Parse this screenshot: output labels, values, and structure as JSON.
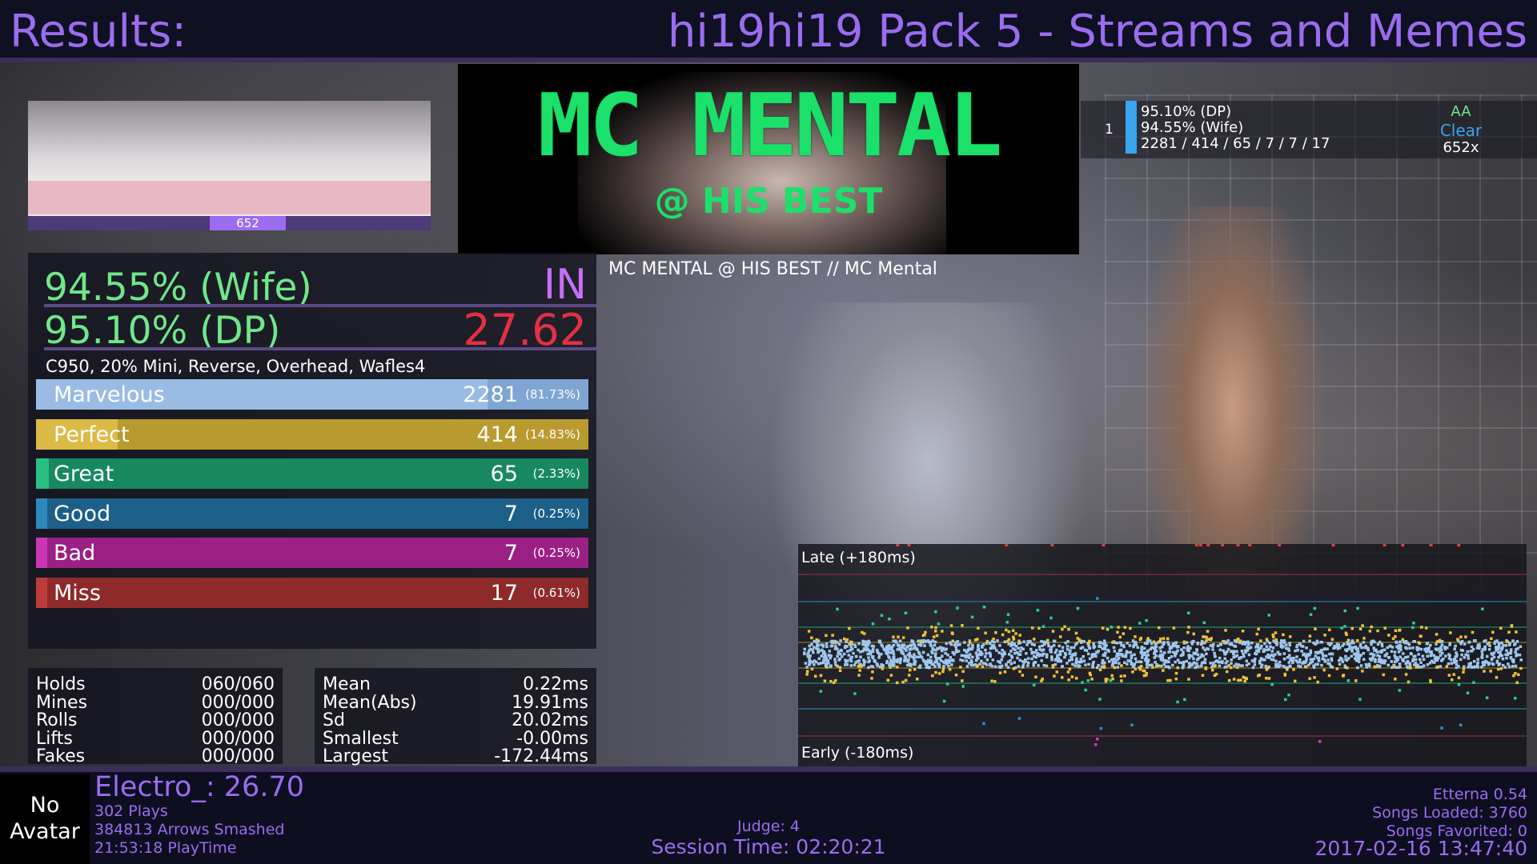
{
  "header": {
    "title": "Results:",
    "pack": "hi19hi19 Pack 5 - Streams and Memes"
  },
  "banner": {
    "title": "MC MENTAL",
    "subtitle": "@ HIS BEST"
  },
  "song": {
    "line": "MC MENTAL @ HIS BEST // MC Mental"
  },
  "lifegraph": {
    "combo_label": "652"
  },
  "score": {
    "wife": "94.55% (Wife)",
    "dp": "95.10% (DP)",
    "grade": "IN",
    "msd": "27.62",
    "mods": "C950, 20% Mini, Reverse, Overhead, Wafles4",
    "colors": {
      "wife": "#6ee88a",
      "grade": "#c56ff5",
      "msd": "#e52f45"
    }
  },
  "judgments": [
    {
      "name": "Marvelous",
      "count": "2281",
      "pct": "(81.73%)",
      "fraction": 0.8173,
      "color": "#7fa5d3",
      "accent": "#9fc0e6"
    },
    {
      "name": "Perfect",
      "count": "414",
      "pct": "(14.83%)",
      "fraction": 0.1483,
      "color": "#b99a2e",
      "accent": "#e2c04a"
    },
    {
      "name": "Great",
      "count": "65",
      "pct": "(2.33%)",
      "fraction": 0.0233,
      "color": "#188860",
      "accent": "#2bc98a"
    },
    {
      "name": "Good",
      "count": "7",
      "pct": "(0.25%)",
      "fraction": 0.0025,
      "color": "#1c5f89",
      "accent": "#2f90c8"
    },
    {
      "name": "Bad",
      "count": "7",
      "pct": "(0.25%)",
      "fraction": 0.0025,
      "color": "#9a2085",
      "accent": "#d43abd"
    },
    {
      "name": "Miss",
      "count": "17",
      "pct": "(0.61%)",
      "fraction": 0.0061,
      "color": "#8e2a2a",
      "accent": "#c44040"
    }
  ],
  "stats_left": [
    {
      "label": "Holds",
      "value": "060/060"
    },
    {
      "label": "Mines",
      "value": "000/000"
    },
    {
      "label": "Rolls",
      "value": "000/000"
    },
    {
      "label": "Lifts",
      "value": "000/000"
    },
    {
      "label": "Fakes",
      "value": "000/000"
    }
  ],
  "stats_right": [
    {
      "label": "Mean",
      "value": "0.22ms"
    },
    {
      "label": "Mean(Abs)",
      "value": "19.91ms"
    },
    {
      "label": "Sd",
      "value": "20.02ms"
    },
    {
      "label": "Smallest",
      "value": "-0.00ms"
    },
    {
      "label": "Largest",
      "value": "-172.44ms"
    }
  ],
  "offset_plot": {
    "late_label": "Late (+180ms)",
    "early_label": "Early (-180ms)"
  },
  "highscore": {
    "rank": "1",
    "dp": "95.10% (DP)",
    "wife": "94.55% (Wife)",
    "judges": "2281 / 414 / 65 / 7 / 7 / 17",
    "grade": "AA",
    "clear": "Clear",
    "combo": "652x",
    "colors": {
      "grade": "#6ee88a",
      "clear": "#3aa6ef",
      "bar": "#3aa6ef"
    }
  },
  "profile": {
    "avatar_line1": "No",
    "avatar_line2": "Avatar",
    "name_rating": "Electro_: 26.70",
    "plays": "302 Plays",
    "arrows": "384813 Arrows Smashed",
    "playtime": "21:53:18 PlayTime"
  },
  "footer": {
    "judge": "Judge: 4",
    "session": "Session Time: 02:20:21",
    "version": "Etterna 0.54",
    "songs_loaded": "Songs Loaded: 3760",
    "songs_favorited": "Songs Favorited: 0",
    "datetime": "2017-02-16 13:47:40"
  },
  "theme": {
    "accent": "#9b6cf0"
  }
}
